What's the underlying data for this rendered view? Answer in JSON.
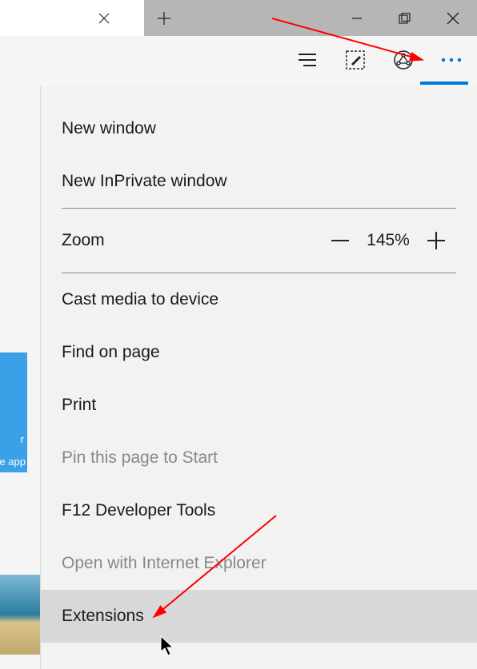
{
  "toolbar": {
    "more_dots": "• • •"
  },
  "menu": {
    "new_window": "New window",
    "new_inprivate": "New InPrivate window",
    "zoom_label": "Zoom",
    "zoom_value": "145%",
    "cast": "Cast media to device",
    "find": "Find on page",
    "print": "Print",
    "pin": "Pin this page to Start",
    "devtools": "F12 Developer Tools",
    "open_ie": "Open with Internet Explorer",
    "extensions": "Extensions"
  },
  "left": {
    "tile_line1": "r",
    "tile_line2": "e app"
  }
}
